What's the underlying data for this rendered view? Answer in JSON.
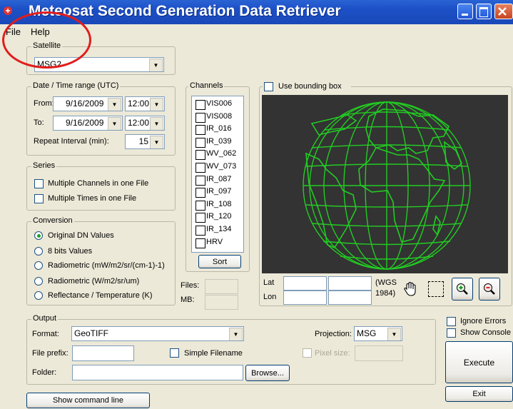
{
  "window": {
    "title": "Meteosat Second Generation Data Retriever"
  },
  "menu": {
    "file": "File",
    "help": "Help"
  },
  "satellite": {
    "legend": "Satellite",
    "value": "MSG2"
  },
  "datetime": {
    "legend": "Date / Time range (UTC)",
    "from_label": "From:",
    "from_date": "9/16/2009",
    "from_time": "12:00",
    "to_label": "To:",
    "to_date": "9/16/2009",
    "to_time": "12:00",
    "repeat_label": "Repeat Interval (min):",
    "repeat_value": "15"
  },
  "series": {
    "legend": "Series",
    "multi_channels": "Multiple Channels in one File",
    "multi_times": "Multiple Times in one File"
  },
  "conversion": {
    "legend": "Conversion",
    "options": [
      "Original DN Values",
      "8 bits Values",
      "Radiometric (mW/m2/sr/(cm-1)-1)",
      "Radiometric (W/m2/sr/um)",
      "Reflectance / Temperature (K)"
    ],
    "selected": "Original DN Values"
  },
  "channels": {
    "legend": "Channels",
    "items": [
      "VIS006",
      "VIS008",
      "IR_016",
      "IR_039",
      "WV_062",
      "WV_073",
      "IR_087",
      "IR_097",
      "IR_108",
      "IR_120",
      "IR_134",
      "HRV"
    ],
    "sort": "Sort",
    "files_label": "Files:",
    "mb_label": "MB:"
  },
  "bbox": {
    "label": "Use bounding box",
    "lat": "Lat",
    "lon": "Lon",
    "wgs": "(WGS 1984)",
    "wgs1": "(WGS",
    "wgs2": "1984)"
  },
  "icons": [
    "hand-icon",
    "select-rect-icon",
    "zoom-in-icon",
    "zoom-out-icon"
  ],
  "output": {
    "legend": "Output",
    "format_label": "Format:",
    "format_value": "GeoTIFF",
    "projection_label": "Projection:",
    "projection_value": "MSG",
    "prefix_label": "File prefix:",
    "simple_filename": "Simple Filename",
    "pixel_size": "Pixel size:",
    "folder_label": "Folder:",
    "browse": "Browse..."
  },
  "options": {
    "ignore_errors": "Ignore Errors",
    "show_console": "Show Console"
  },
  "actions": {
    "execute": "Execute",
    "exit": "Exit",
    "show_command_line": "Show command line"
  },
  "colors": {
    "title_bar": "#1c4fc6",
    "map_bg": "#333333",
    "map_lines": "#22cc22",
    "annotation": "#e21c1c"
  }
}
